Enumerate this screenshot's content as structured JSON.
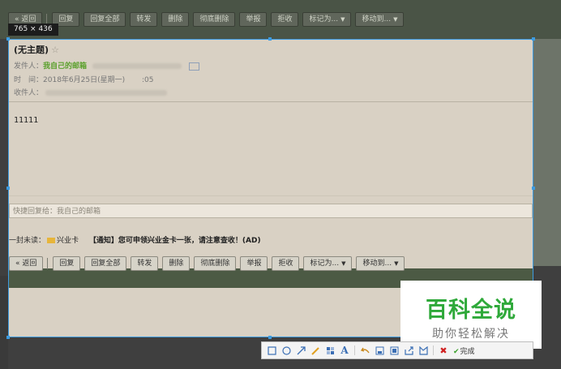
{
  "toolbar": {
    "back": "« 返回",
    "reply": "回复",
    "reply_all": "回复全部",
    "forward": "转发",
    "delete": "删除",
    "delete_forever": "彻底删除",
    "report": "举报",
    "reject": "拒收",
    "mark_as": "标记为...",
    "move_to": "移动到..."
  },
  "selection": {
    "size_label": "765 × 436"
  },
  "mail": {
    "subject": "(无主题)",
    "star": "☆",
    "from_label": "发件人：",
    "from_name": "我自己的邮箱",
    "time_label": "时　间：",
    "time_value": "2018年6月25日(星期一) 　　:05",
    "to_label": "收件人：",
    "body": "11111"
  },
  "quick_reply": {
    "placeholder": "快捷回复给：我自己的邮箱"
  },
  "next_mail": {
    "label": "下一封未读：",
    "sender": "兴业卡",
    "subject": "【通知】您可申领兴业金卡一张，请注意查收！(AD)"
  },
  "watermark": {
    "title": "百科全说",
    "subtitle": "助你轻松解决"
  },
  "screenshot_tool": {
    "done_label": "完成"
  },
  "colors": {
    "selection_border": "#3d9be0",
    "watermark_green": "#2fa93a"
  }
}
